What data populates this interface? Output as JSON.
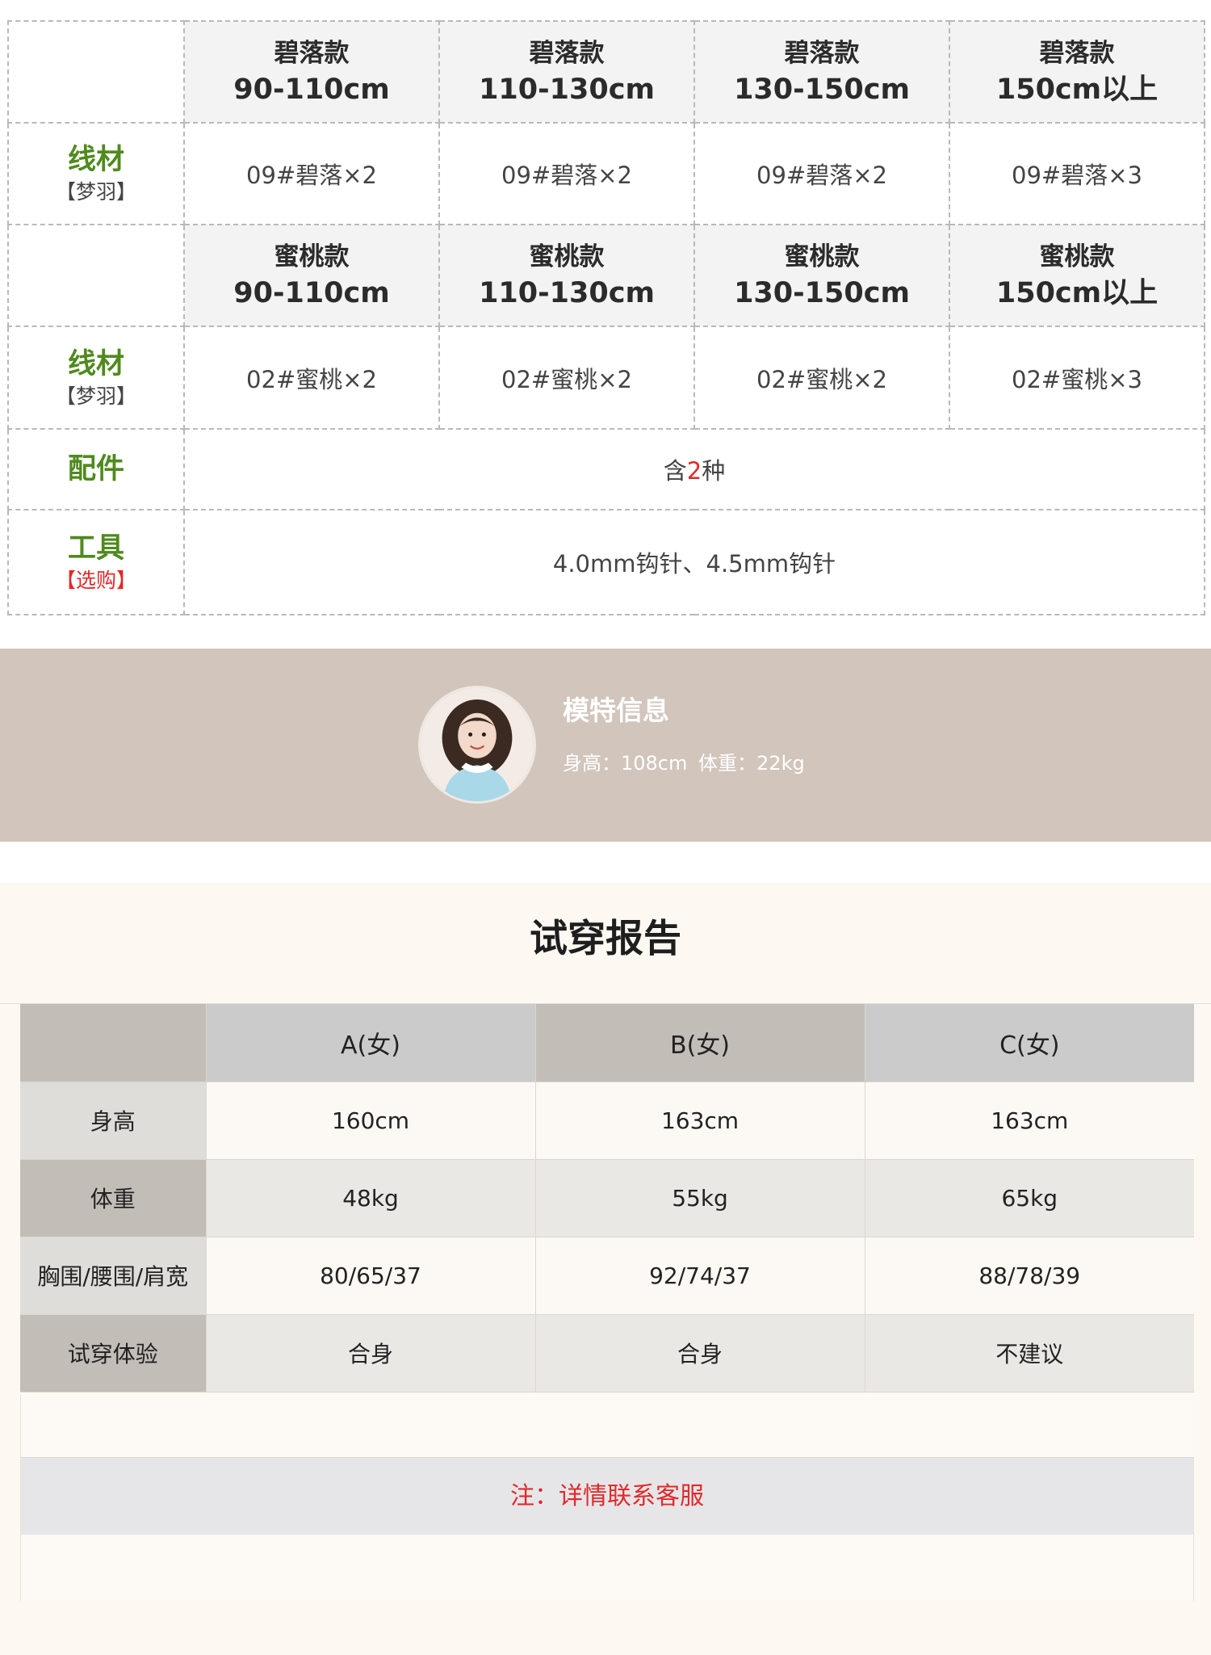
{
  "materials": {
    "bilu_header": [
      {
        "name": "碧落款",
        "size": "90-110cm"
      },
      {
        "name": "碧落款",
        "size": "110-130cm"
      },
      {
        "name": "碧落款",
        "size": "130-150cm"
      },
      {
        "name": "碧落款",
        "size": "150cm以上"
      }
    ],
    "bilu_yarn": {
      "label": "线材",
      "sub": "【梦羽】",
      "values": [
        "09#碧落×2",
        "09#碧落×2",
        "09#碧落×2",
        "09#碧落×3"
      ]
    },
    "mitao_header": [
      {
        "name": "蜜桃款",
        "size": "90-110cm"
      },
      {
        "name": "蜜桃款",
        "size": "110-130cm"
      },
      {
        "name": "蜜桃款",
        "size": "130-150cm"
      },
      {
        "name": "蜜桃款",
        "size": "150cm以上"
      }
    ],
    "mitao_yarn": {
      "label": "线材",
      "sub": "【梦羽】",
      "values": [
        "02#蜜桃×2",
        "02#蜜桃×2",
        "02#蜜桃×2",
        "02#蜜桃×3"
      ]
    },
    "accessories": {
      "label": "配件",
      "prefix": "含",
      "count": "2",
      "suffix": "种"
    },
    "tools": {
      "label": "工具",
      "sub": "【选购】",
      "value": "4.0mm钩针、4.5mm钩针"
    }
  },
  "model": {
    "title": "模特信息",
    "height": "身高：108cm",
    "weight": "体重：22kg"
  },
  "report": {
    "title": "试穿报告",
    "columns": [
      "A(女)",
      "B(女)",
      "C(女)"
    ],
    "rows": [
      {
        "label": "身高",
        "values": [
          "160cm",
          "163cm",
          "163cm"
        ]
      },
      {
        "label": "体重",
        "values": [
          "48kg",
          "55kg",
          "65kg"
        ]
      },
      {
        "label": "胸围/腰围/肩宽",
        "values": [
          "80/65/37",
          "92/74/37",
          "88/78/39"
        ]
      },
      {
        "label": "试穿体验",
        "values": [
          "合身",
          "合身",
          "不建议"
        ]
      }
    ],
    "note": "注：详情联系客服"
  },
  "colors": {
    "label_green": "#4f8a1e",
    "accent_red": "#e02a2a",
    "model_band": "#d1c5bc",
    "report_bg": "#fdf8f2"
  }
}
